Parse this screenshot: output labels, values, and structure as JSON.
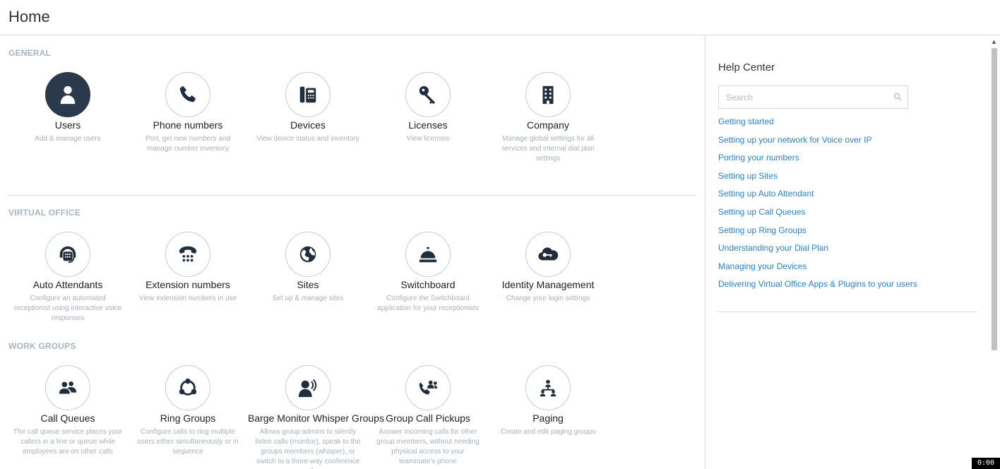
{
  "page": {
    "title": "Home"
  },
  "sections": {
    "general": {
      "label": "GENERAL",
      "tiles": [
        {
          "title": "Users",
          "desc": "Add & manage users",
          "icon": "user-icon"
        },
        {
          "title": "Phone numbers",
          "desc": "Port, get new numbers and manage number inventory",
          "icon": "phone-icon"
        },
        {
          "title": "Devices",
          "desc": "View device status and inventory",
          "icon": "desk-phone-icon"
        },
        {
          "title": "Licenses",
          "desc": "View licenses",
          "icon": "key-icon"
        },
        {
          "title": "Company",
          "desc": "Manage global settings for all services and internal dial plan settings",
          "icon": "building-icon"
        }
      ]
    },
    "virtual_office": {
      "label": "VIRTUAL OFFICE",
      "tiles": [
        {
          "title": "Auto Attendants",
          "desc": "Configure an automated receptionist using interactive voice responses",
          "icon": "headset-phone-icon"
        },
        {
          "title": "Extension numbers",
          "desc": "View extension numbers in use",
          "icon": "telephone-keypad-icon"
        },
        {
          "title": "Sites",
          "desc": "Set up & manage sites",
          "icon": "globe-icon"
        },
        {
          "title": "Switchboard",
          "desc": "Configure the Switchboard application for your receptionists",
          "icon": "service-bell-icon"
        },
        {
          "title": "Identity Management",
          "desc": "Change your login settings",
          "icon": "cloud-key-icon"
        }
      ]
    },
    "work_groups": {
      "label": "WORK GROUPS",
      "tiles": [
        {
          "title": "Call Queues",
          "desc": "The call queue service places your callers in a line or queue while employees are on other calls",
          "icon": "users-group-icon"
        },
        {
          "title": "Ring Groups",
          "desc": "Configure calls to ring multiple users either simultaneously or in sequence",
          "icon": "ring-group-icon"
        },
        {
          "title": "Barge Monitor Whisper Groups",
          "desc": "Allows group admins to silently listen calls (monitor), speak to the groups members (whisper), or switch to a three-way conference call",
          "icon": "speaking-person-icon"
        },
        {
          "title": "Group Call Pickups",
          "desc": "Answer incoming calls for other group members, without needing physical access to your teammate's phone",
          "icon": "phone-users-icon"
        },
        {
          "title": "Paging",
          "desc": "Create and edit paging groups",
          "icon": "paging-tree-icon"
        }
      ]
    }
  },
  "help_center": {
    "title": "Help Center",
    "search_placeholder": "Search",
    "links": [
      "Getting started",
      "Setting up your network for Voice over IP",
      "Porting your numbers",
      "Setting up Sites",
      "Setting up Auto Attendant",
      "Setting up Call Queues",
      "Setting up Ring Groups",
      "Understanding your Dial Plan",
      "Managing your Devices",
      "Delivering Virtual Office Apps & Plugins to your users"
    ]
  },
  "timer": "0:00",
  "colors": {
    "accent": "#2b82c9",
    "icon": "#1f2d3d",
    "active_circle": "#2a3a4c",
    "section_label": "#a9b6c4"
  }
}
